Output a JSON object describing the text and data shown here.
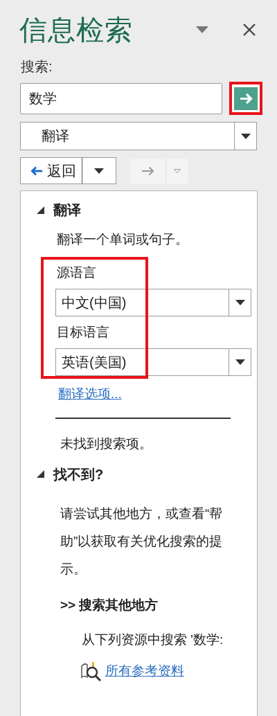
{
  "pane": {
    "title": "信息检索"
  },
  "search": {
    "label": "搜索:",
    "value": "数学",
    "go_highlighted": true
  },
  "service": {
    "value": "翻译"
  },
  "nav": {
    "back": "返回",
    "forward_disabled": true
  },
  "translate": {
    "heading": "翻译",
    "expanded": true,
    "description": "翻译一个单词或句子。",
    "highlighted": true,
    "source_label": "源语言",
    "source_value": "中文(中国)",
    "target_label": "目标语言",
    "target_value": "英语(美国)",
    "options_link": "翻译选项..."
  },
  "results": {
    "message": "未找到搜索项。",
    "heading": "找不到?",
    "expanded": true,
    "hint": "请尝试其他地方，或查看“帮助”以获取有关优化搜索的提示。",
    "other_heading": ">> 搜索其他地方",
    "other_text": "从下列资源中搜索 '数学:",
    "link": "所有参考资料"
  }
}
